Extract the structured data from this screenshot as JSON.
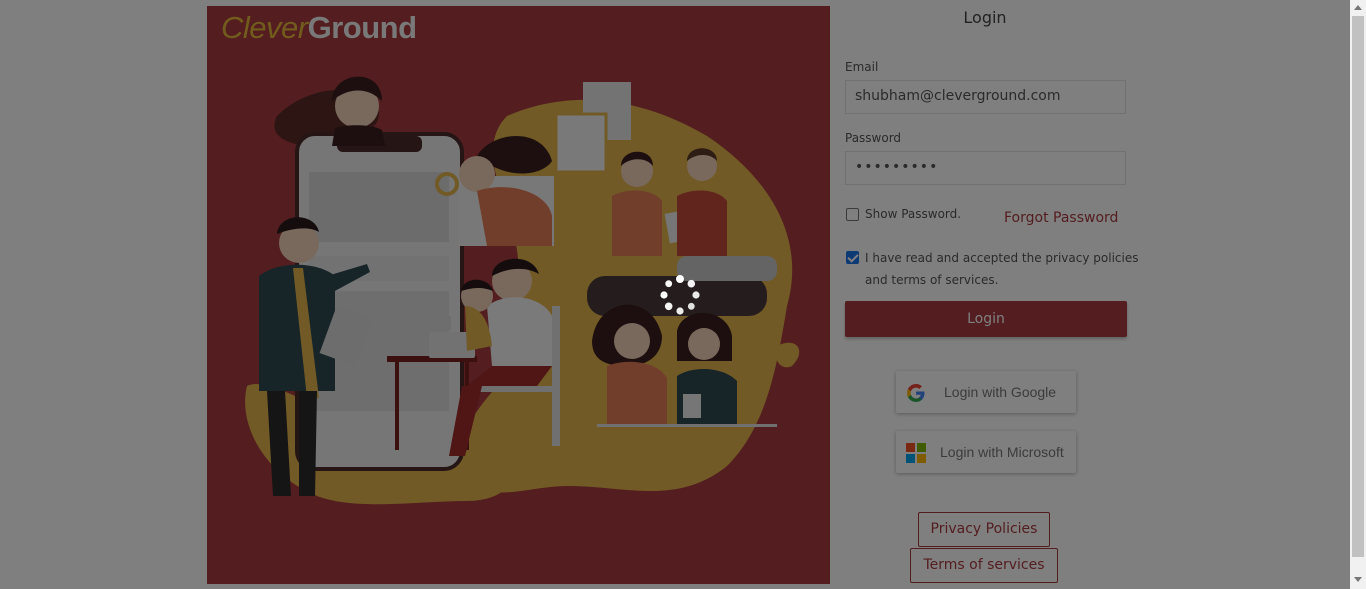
{
  "brand": {
    "logo_part1": "Clever",
    "logo_part2": "Ground"
  },
  "form": {
    "title": "Login",
    "email_label": "Email",
    "email_value": "shubham@cleverground.com",
    "password_label": "Password",
    "password_value": "•••••••••",
    "show_password_label": "Show Password.",
    "show_password_checked": false,
    "forgot_password": "Forgot Password",
    "accept_label_line1": "I have read and accepted the privacy policies",
    "accept_label_line2": "and terms of services.",
    "accept_checked": true,
    "login_button": "Login"
  },
  "sso": {
    "google_label": "Login with Google",
    "microsoft_label": "Login with Microsoft"
  },
  "links": {
    "privacy": "Privacy Policies",
    "terms": "Terms of services"
  },
  "state": {
    "loading": true,
    "overlay_icon": "loading-spinner-icon"
  },
  "colors": {
    "brand_red": "#a83b3f",
    "brand_gold": "#e4b83a",
    "checkbox_blue": "#1a73e8"
  }
}
